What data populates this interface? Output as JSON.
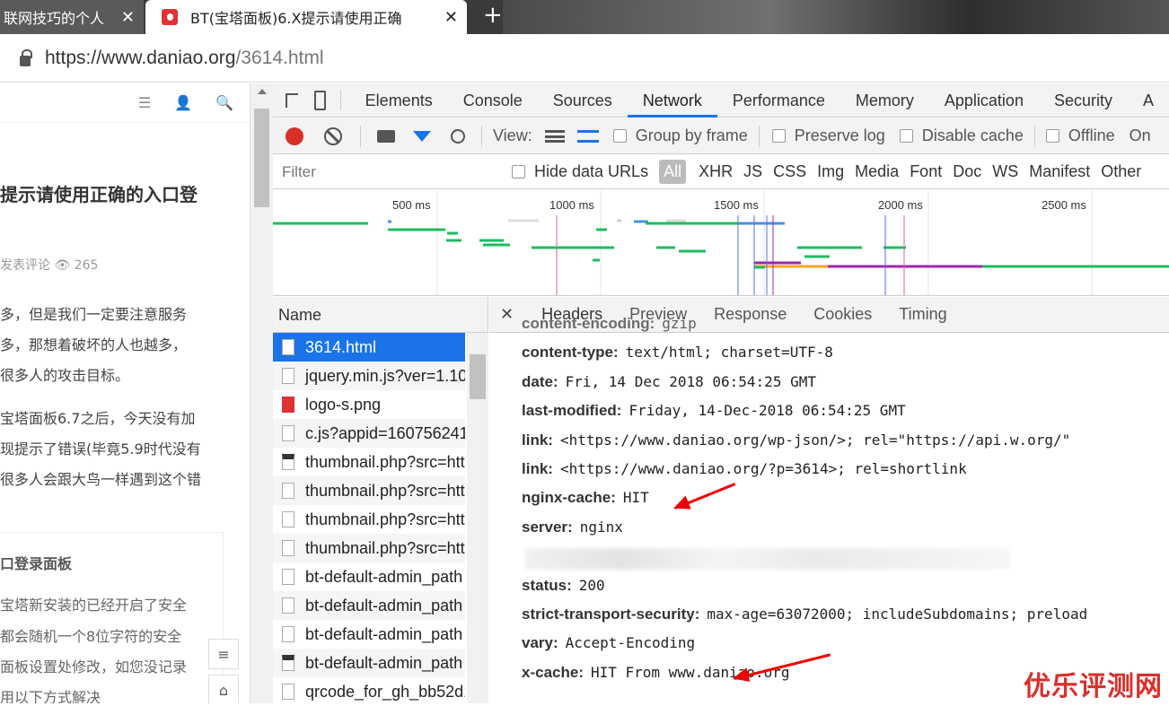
{
  "browser": {
    "tabs": [
      {
        "title": "联网技巧的个人",
        "close": "✕"
      },
      {
        "title": "BT(宝塔面板)6.X提示请使用正确",
        "close": "✕"
      }
    ],
    "new_tab": "+",
    "url_host": "https://www.daniao.org",
    "url_path": "/3614.html"
  },
  "page": {
    "icons": [
      "menu-icon",
      "user-icon",
      "search-icon"
    ],
    "title": "提示请使用正确的入口登",
    "meta": "发表评论  👁 265",
    "paragraphs": [
      "多，但是我们一定要注意服务",
      "多，那想着破坏的人也越多，",
      "很多人的攻击目标。",
      "宝塔面板6.7之后，今天没有加",
      "现提示了错误(毕竟5.9时代没有",
      "很多人会跟大鸟一样遇到这个错"
    ],
    "box_title": "口登录面板",
    "box_lines": [
      "宝塔新安装的已经开启了安全",
      "都会随机一个8位字符的安全",
      "面板设置处修改，如您没记录",
      "用以下方式解决"
    ],
    "float_buttons": [
      "≡",
      "⌂"
    ]
  },
  "devtools": {
    "tabs": [
      "Elements",
      "Console",
      "Sources",
      "Network",
      "Performance",
      "Memory",
      "Application",
      "Security",
      "A"
    ],
    "active_tab": "Network",
    "toolbar": {
      "view_label": "View:",
      "group_by_frame": "Group by frame",
      "preserve_log": "Preserve log",
      "disable_cache": "Disable cache",
      "offline": "Offline",
      "online": "On"
    },
    "filter": {
      "placeholder": "Filter",
      "hide_data_urls": "Hide data URLs",
      "types": [
        "All",
        "XHR",
        "JS",
        "CSS",
        "Img",
        "Media",
        "Font",
        "Doc",
        "WS",
        "Manifest",
        "Other"
      ]
    },
    "timeline_ticks": [
      "500 ms",
      "1000 ms",
      "1500 ms",
      "2000 ms",
      "2500 ms"
    ],
    "name_header": "Name",
    "requests": [
      "3614.html",
      "jquery.min.js?ver=1.10.",
      "logo-s.png",
      "c.js?appid=160756241",
      "thumbnail.php?src=htt",
      "thumbnail.php?src=htt",
      "thumbnail.php?src=htt",
      "thumbnail.php?src=htt",
      "bt-default-admin_path",
      "bt-default-admin_path",
      "bt-default-admin_path",
      "bt-default-admin_path",
      "qrcode_for_gh_bb52d1"
    ],
    "detail_tabs": [
      "Headers",
      "Preview",
      "Response",
      "Cookies",
      "Timing"
    ],
    "detail_close": "✕",
    "headers": [
      {
        "k": "content-encoding:",
        "v": "gzip"
      },
      {
        "k": "content-type:",
        "v": "text/html; charset=UTF-8"
      },
      {
        "k": "date:",
        "v": "Fri, 14 Dec 2018 06:54:25 GMT"
      },
      {
        "k": "last-modified:",
        "v": "Friday, 14-Dec-2018 06:54:25 GMT"
      },
      {
        "k": "link:",
        "v": "<https://www.daniao.org/wp-json/>; rel=\"https://api.w.org/\""
      },
      {
        "k": "link:",
        "v": "<https://www.daniao.org/?p=3614>; rel=shortlink"
      },
      {
        "k": "nginx-cache:",
        "v": "HIT"
      },
      {
        "k": "server:",
        "v": "nginx"
      },
      {
        "k": "",
        "v": ""
      },
      {
        "k": "status:",
        "v": "200"
      },
      {
        "k": "strict-transport-security:",
        "v": "max-age=63072000; includeSubdomains; preload"
      },
      {
        "k": "vary:",
        "v": "Accept-Encoding"
      },
      {
        "k": "x-cache:",
        "v": "HIT From www.daniao.org"
      }
    ]
  },
  "watermark": "优乐评测网"
}
